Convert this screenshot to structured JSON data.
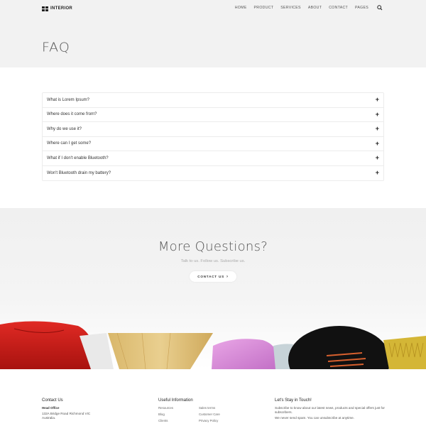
{
  "header": {
    "logo_text": "INTERIOR",
    "nav": [
      "HOME",
      "PRODUCT",
      "SERVICES",
      "ABOUT",
      "CONTACT",
      "PAGES"
    ],
    "page_title": "FAQ"
  },
  "faq": {
    "questions": [
      "What is Lorem Ipsum?",
      "Where does it come from?",
      "Why do we use it?",
      "Where can I get some?",
      "What if I don't enable Bluetooth?",
      "Won't Bluetooth drain my battery?"
    ],
    "expand_icon": "+"
  },
  "more_questions": {
    "title": "More Questions?",
    "subtitle": "Talk to us. Follow us. Subscribe us.",
    "button_label": "CONTACT US",
    "button_icon": "›"
  },
  "footer": {
    "contact": {
      "heading": "Contact Us",
      "office_label": "Head Office",
      "address_line1": "132A Bridge Road Richmond VIC",
      "address_line2": "Australia."
    },
    "useful": {
      "heading": "Useful Information",
      "col1": [
        "Resources",
        "Blog",
        "Clients"
      ],
      "col2": [
        "Sales terms",
        "Customer Care",
        "Privacy Policy"
      ]
    },
    "newsletter": {
      "heading": "Let's Stay in Touch!",
      "text1": "Subscribe to know about our latest news, products and special offers just for subscribers.",
      "text2": "We never send spam. You can unsubscribe at anytime."
    }
  },
  "icons": {
    "logo": "grid-icon",
    "search": "search-icon",
    "chevron": "chevron-right-icon"
  }
}
